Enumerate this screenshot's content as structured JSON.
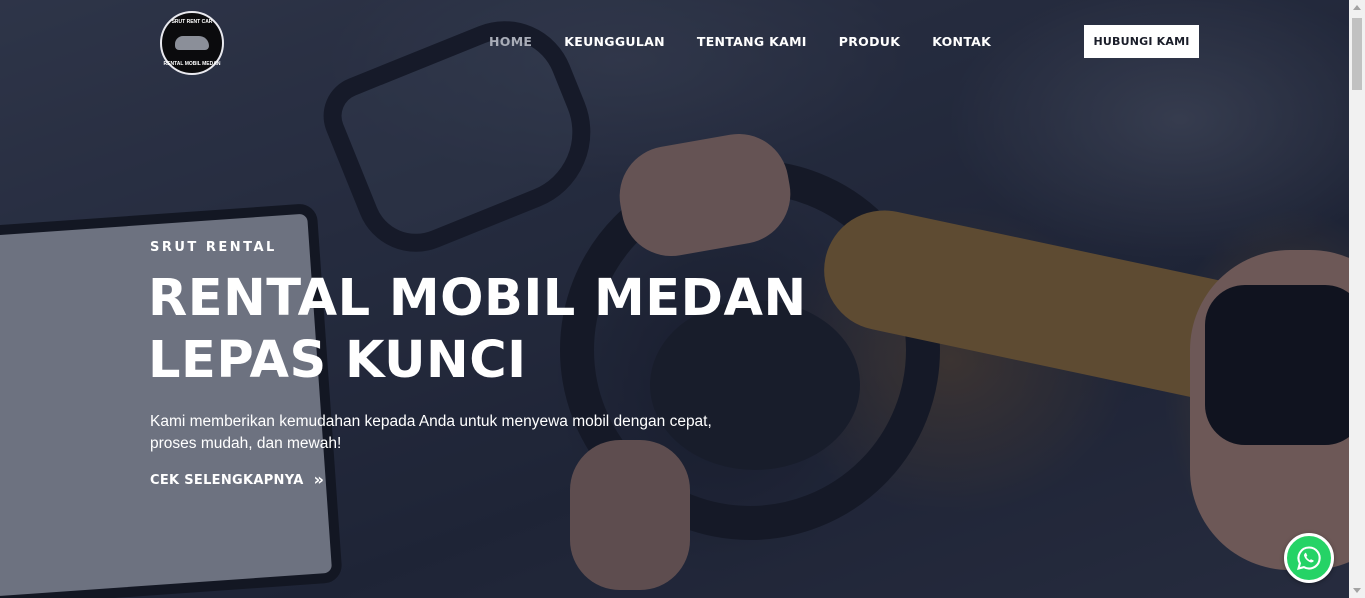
{
  "brand": {
    "logo_top_text": "SRUT RENT CAR",
    "logo_bottom_text": "RENTAL MOBIL MEDAN"
  },
  "nav": {
    "items": [
      {
        "label": "HOME",
        "active": true
      },
      {
        "label": "KEUNGGULAN",
        "active": false
      },
      {
        "label": "TENTANG KAMI",
        "active": false
      },
      {
        "label": "PRODUK",
        "active": false
      },
      {
        "label": "KONTAK",
        "active": false
      }
    ],
    "cta_label": "HUBUNGI KAMI"
  },
  "hero": {
    "eyebrow": "SRUT RENTAL",
    "headline_line1": "RENTAL MOBIL MEDAN",
    "headline_line2": "LEPAS KUNCI",
    "description": "Kami memberikan kemudahan kepada Anda untuk menyewa mobil dengan cepat, proses mudah, dan mewah!",
    "link_label": "CEK SELENGKAPNYA"
  },
  "icons": {
    "logo": "car-logo-icon",
    "link_arrow": "double-chevron-right-icon",
    "whatsapp": "whatsapp-icon"
  },
  "colors": {
    "overlay": "#141a2c",
    "whatsapp": "#25d366",
    "nav_active": "#a9adb8"
  }
}
